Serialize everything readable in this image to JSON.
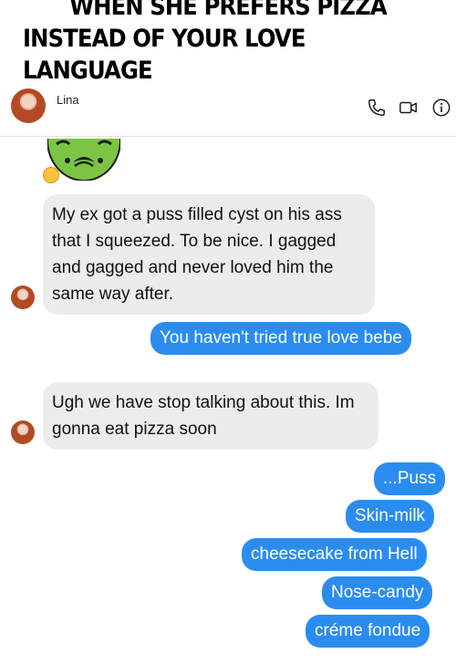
{
  "caption": {
    "line1": "WHEN SHE PREFERS PIZZA",
    "line2": "INSTEAD OF YOUR LOVE LANGUAGE"
  },
  "header": {
    "contact_name": "Lina",
    "icons": [
      "phone-icon",
      "video-icon",
      "info-icon"
    ]
  },
  "messages": [
    {
      "from": "contact",
      "text": "My ex got a puss filled cyst on his ass that I squeezed. To be nice. I gagged and gagged and never loved him the same way after."
    },
    {
      "from": "me",
      "text": "You haven't tried true love bebe"
    },
    {
      "from": "contact",
      "text": "Ugh we have stop talking about this. Im gonna eat pizza soon"
    },
    {
      "from": "me",
      "text": "...Puss"
    },
    {
      "from": "me",
      "text": "Skin-milk"
    },
    {
      "from": "me",
      "text": "cheesecake from Hell"
    },
    {
      "from": "me",
      "text": "Nose-candy"
    },
    {
      "from": "me",
      "text": "créme fondue"
    }
  ],
  "colors": {
    "outgoing_bubble": "#2b8cf0",
    "incoming_bubble": "#ececec",
    "reaction_emoji": "#7cc443"
  }
}
